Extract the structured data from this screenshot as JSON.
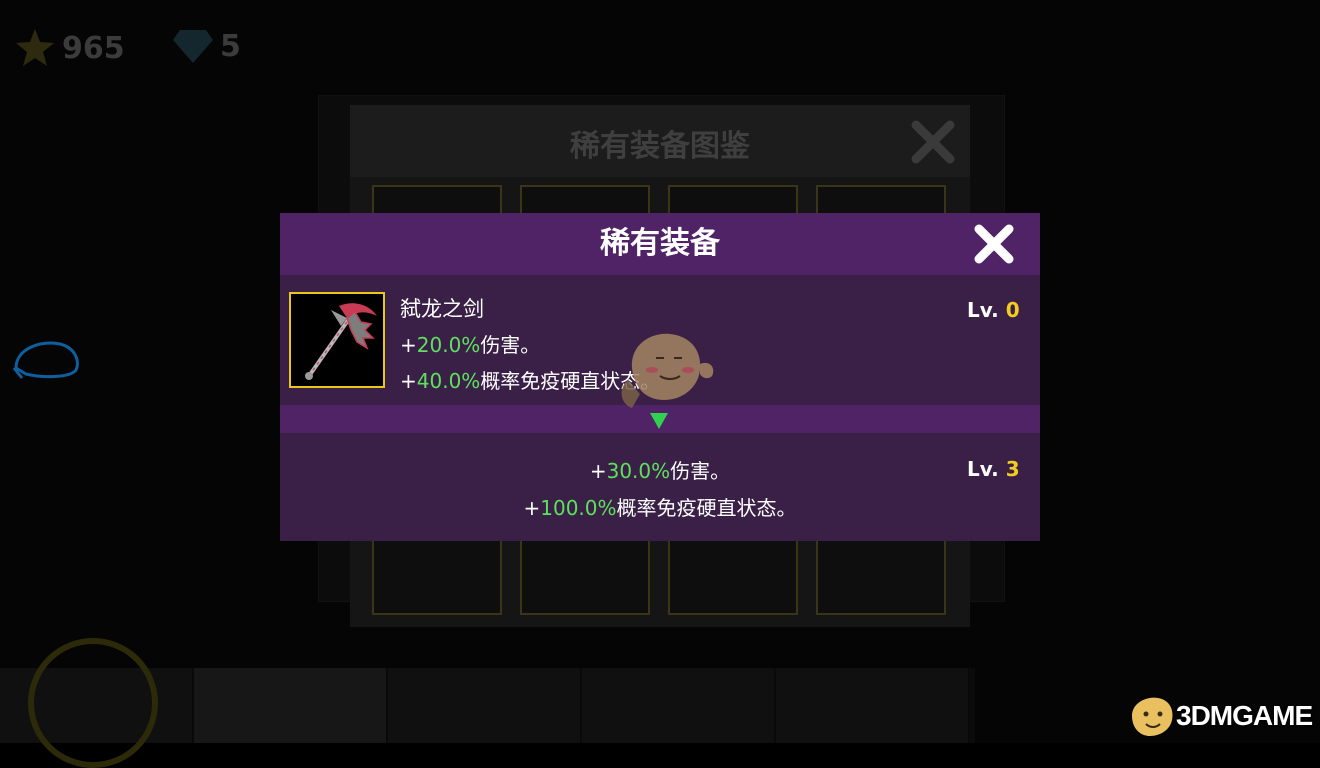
{
  "hud": {
    "gold_value": "965",
    "gem_value": "5"
  },
  "background_panel": {
    "title": "稀有装备图鉴"
  },
  "popup": {
    "title": "稀有装备",
    "item": {
      "name": "弑龙之剑",
      "current_level_label": "Lv.",
      "current_level_value": "0",
      "current_stats": [
        {
          "prefix": "+",
          "value": "20.0%",
          "text": "伤害。"
        },
        {
          "prefix": "+",
          "value": "40.0%",
          "text": "概率免疫硬直状态。"
        }
      ],
      "next_level_label": "Lv.",
      "next_level_value": "3",
      "next_stats": [
        {
          "prefix": "+",
          "value": "30.0%",
          "text": "伤害。"
        },
        {
          "prefix": "+",
          "value": "100.0%",
          "text": "概率免疫硬直状态。"
        }
      ]
    }
  },
  "watermark": {
    "text": "3DMGAME"
  },
  "colors": {
    "popup_header": "#4f2365",
    "popup_body": "#3a2046",
    "stat_green": "#5ee05e",
    "level_gold": "#f2cd20",
    "item_frame": "#e8c81a"
  },
  "icons": [
    "star-icon",
    "gem-icon",
    "close-icon",
    "scythe-icon",
    "arrow-down-icon",
    "mascot-icon"
  ]
}
